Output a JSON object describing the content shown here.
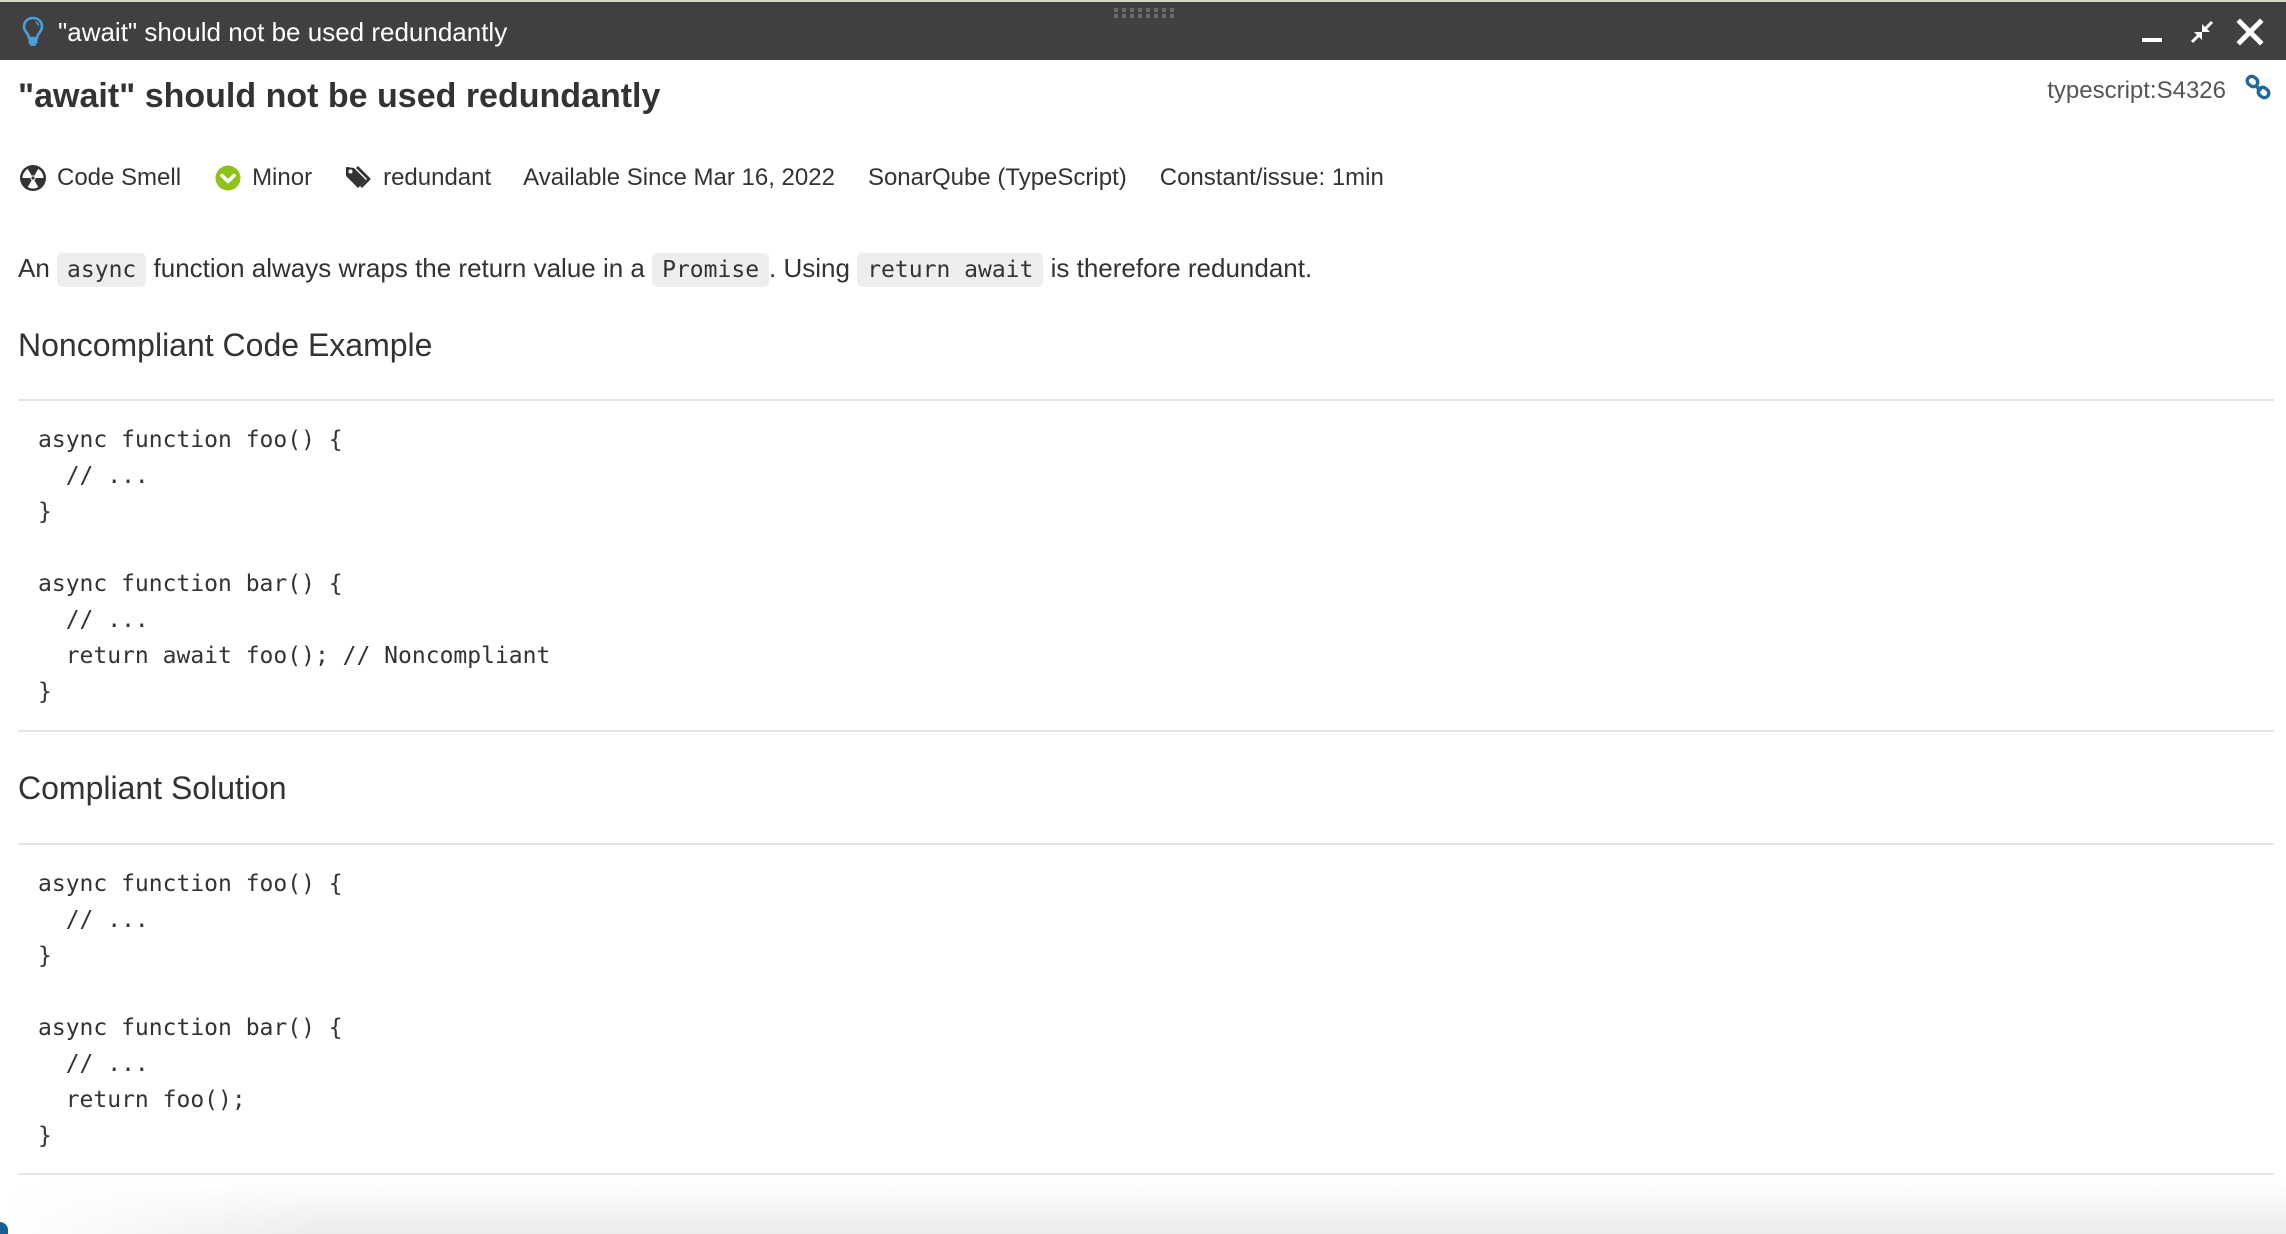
{
  "window": {
    "title": "\"await\" should not be used redundantly",
    "icon": "lightbulb-icon",
    "controls": {
      "minimize": "minimize-icon",
      "restore": "restore-icon",
      "close": "close-icon"
    }
  },
  "rule": {
    "title": "\"await\" should not be used redundantly",
    "key": "typescript:S4326",
    "link_icon": "link-icon",
    "meta": {
      "type": {
        "icon": "code-smell-icon",
        "label": "Code Smell"
      },
      "severity": {
        "icon": "minor-severity-icon",
        "label": "Minor",
        "color": "#8ec21a"
      },
      "tag": {
        "icon": "tags-icon",
        "label": "redundant"
      },
      "available_since": "Available Since Mar 16, 2022",
      "repository": "SonarQube (TypeScript)",
      "remediation": "Constant/issue: 1min"
    },
    "description": {
      "part1": "An ",
      "code1": "async",
      "part2": " function always wraps the return value in a ",
      "code2": "Promise",
      "part3": ". Using ",
      "code3": "return await",
      "part4": " is therefore redundant."
    },
    "sections": [
      {
        "title": "Noncompliant Code Example",
        "code": "async function foo() {\n  // ...\n}\n\nasync function bar() {\n  // ...\n  return await foo(); // Noncompliant\n}"
      },
      {
        "title": "Compliant Solution",
        "code": "async function foo() {\n  // ...\n}\n\nasync function bar() {\n  // ...\n  return foo();\n}"
      }
    ]
  },
  "colors": {
    "titlebar_bg": "#404040",
    "accent_blue": "#236a97",
    "bulb_blue": "#4a9fd8",
    "severity_green": "#8ec21a",
    "text": "#333333",
    "divider": "#e6e6e6"
  }
}
